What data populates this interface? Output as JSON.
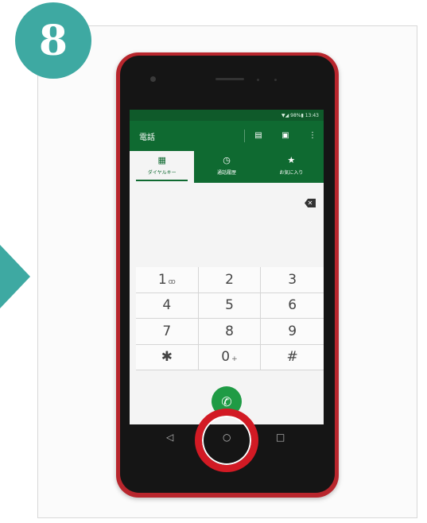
{
  "step_number": "8",
  "status_bar": {
    "text": "▼◢ 98%▮ 13:43"
  },
  "app": {
    "title": "電話",
    "tabs": [
      {
        "label": "ダイヤルキー",
        "icon": "▦"
      },
      {
        "label": "通話履歴",
        "icon": "◷"
      },
      {
        "label": "お気に入り",
        "icon": "★"
      }
    ],
    "appbar_icons": [
      "keypad-icon",
      "contacts-icon",
      "more-icon"
    ]
  },
  "keypad": {
    "keys": [
      {
        "main": "1",
        "sub": "ꝏ"
      },
      {
        "main": "2",
        "sub": ""
      },
      {
        "main": "3",
        "sub": ""
      },
      {
        "main": "4",
        "sub": ""
      },
      {
        "main": "5",
        "sub": ""
      },
      {
        "main": "6",
        "sub": ""
      },
      {
        "main": "7",
        "sub": ""
      },
      {
        "main": "8",
        "sub": ""
      },
      {
        "main": "9",
        "sub": ""
      },
      {
        "main": "✱",
        "sub": ""
      },
      {
        "main": "0",
        "sub": "+"
      },
      {
        "main": "#",
        "sub": ""
      }
    ]
  },
  "nav": {
    "back": "◁",
    "home": "○",
    "recents": "□"
  },
  "colors": {
    "teal": "#3ea9a2",
    "green": "#0f6a31",
    "red": "#d21a24",
    "phone_body": "#b8262d"
  }
}
